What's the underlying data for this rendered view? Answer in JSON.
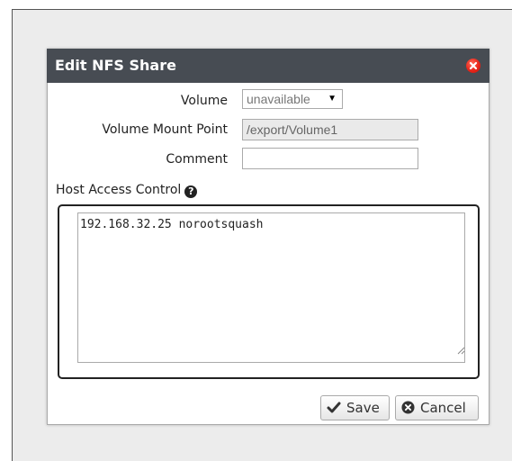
{
  "dialog": {
    "title": "Edit NFS Share",
    "close_icon": "close-icon",
    "close_color": "#e8261a",
    "titlebar_color": "#474c53"
  },
  "form": {
    "volume_label": "Volume",
    "volume_value": "unavailable",
    "mount_label": "Volume Mount Point",
    "mount_value": "/export/Volume1",
    "comment_label": "Comment",
    "comment_value": ""
  },
  "host_access": {
    "label": "Host Access Control",
    "help_icon": "question-circle-icon",
    "text": "192.168.32.25 norootsquash"
  },
  "buttons": {
    "save_label": "Save",
    "save_icon": "check-icon",
    "cancel_label": "Cancel",
    "cancel_icon": "times-circle-icon"
  }
}
